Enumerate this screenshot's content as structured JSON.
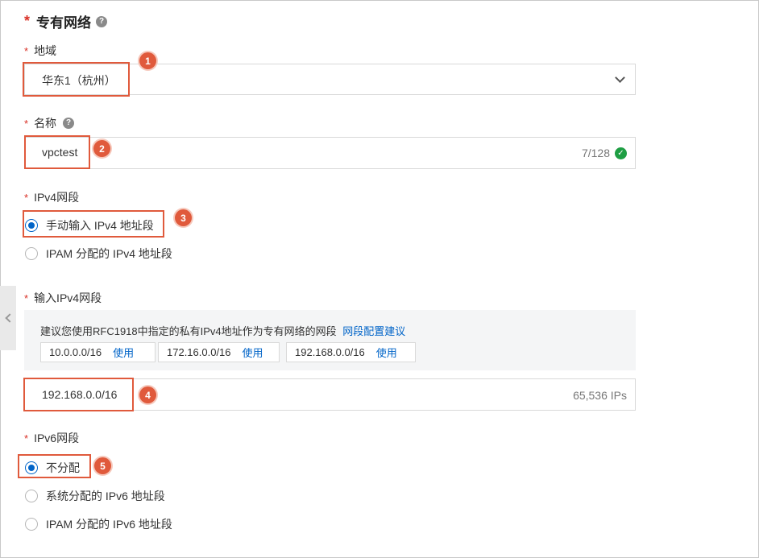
{
  "section": {
    "required_mark": "*",
    "title": "专有网络",
    "help": "?"
  },
  "region": {
    "required_mark": "*",
    "label": "地域",
    "value": "华东1（杭州）",
    "badge": "1"
  },
  "name": {
    "required_mark": "*",
    "label": "名称",
    "help": "?",
    "value": "vpctest",
    "counter": "7/128",
    "badge": "2"
  },
  "ipv4": {
    "required_mark": "*",
    "label": "IPv4网段",
    "options": [
      "手动输入 IPv4 地址段",
      "IPAM 分配的 IPv4 地址段"
    ],
    "selected": 0,
    "badge": "3"
  },
  "ipv4_input": {
    "required_mark": "*",
    "label": "输入IPv4网段",
    "hint": "建议您使用RFC1918中指定的私有IPv4地址作为专有网络的网段",
    "hint_link": "网段配置建议",
    "suggestions": [
      {
        "cidr": "10.0.0.0/16",
        "action": "使用"
      },
      {
        "cidr": "172.16.0.0/16",
        "action": "使用"
      },
      {
        "cidr": "192.168.0.0/16",
        "action": "使用"
      }
    ],
    "value": "192.168.0.0/16",
    "ip_count": "65,536 IPs",
    "badge": "4"
  },
  "ipv6": {
    "required_mark": "*",
    "label": "IPv6网段",
    "options": [
      "不分配",
      "系统分配的 IPv6 地址段",
      "IPAM 分配的 IPv6 地址段"
    ],
    "selected": 0,
    "badge": "5"
  },
  "colors": {
    "accent": "#0064c8",
    "highlight": "#e05a3c",
    "required": "#d93026",
    "success": "#1e9e43"
  }
}
